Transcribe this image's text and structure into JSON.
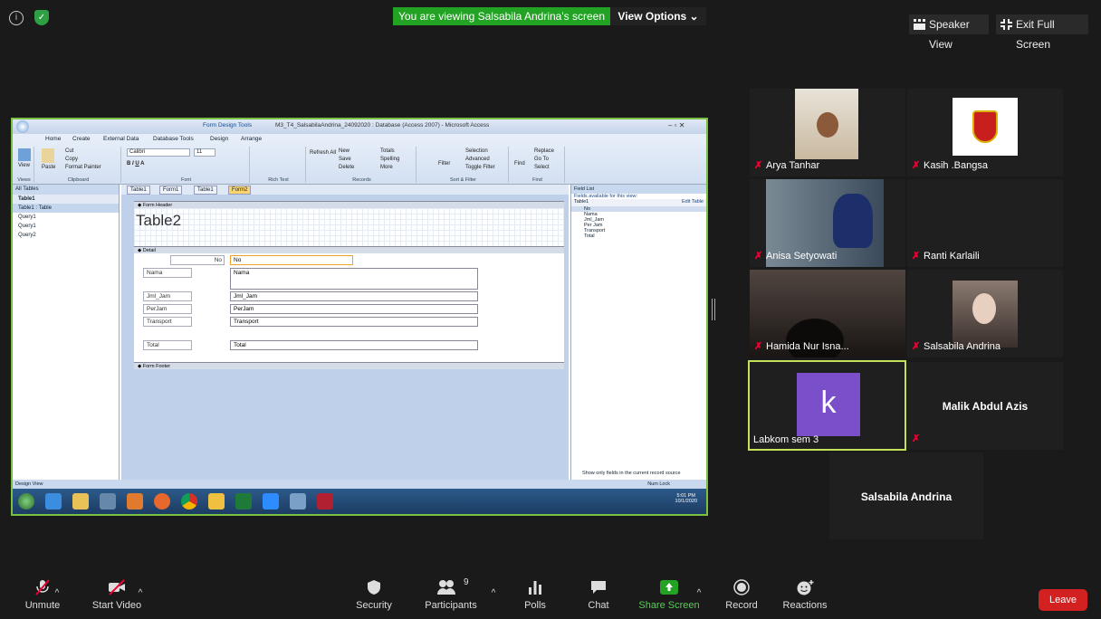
{
  "top": {
    "banner": "You are viewing Salsabila Andrina's screen",
    "view_options": "View Options ⌄",
    "speaker_view": "Speaker View",
    "exit_full_screen": "Exit Full Screen"
  },
  "access": {
    "contextual_tab": "Form Design Tools",
    "window_title": "M3_T4_SalsabilaAndrina_24092020 : Database (Access 2007) - Microsoft Access",
    "ribbon_tabs": [
      "Home",
      "Create",
      "External Data",
      "Database Tools",
      "Design",
      "Arrange"
    ],
    "groups": [
      "Views",
      "Clipboard",
      "Font",
      "Rich Text",
      "Records",
      "Sort & Filter",
      "Find"
    ],
    "clipboard": [
      "Cut",
      "Copy",
      "Format Painter"
    ],
    "view_label": "View",
    "paste_label": "Paste",
    "font_name": "Calibri",
    "font_size": "11",
    "records": [
      "New",
      "Save",
      "Delete",
      "Totals",
      "Spelling",
      "More"
    ],
    "refresh": "Refresh All",
    "sort_filter": [
      "Selection",
      "Advanced",
      "Toggle Filter"
    ],
    "filter": "Filter",
    "find": [
      "Replace",
      "Go To",
      "Select"
    ],
    "find_label": "Find",
    "nav_header": "All Tables",
    "nav_group": "Table1",
    "nav_items": [
      "Table1 : Table",
      "Query1",
      "Query1",
      "Query2"
    ],
    "doc_tabs": [
      "Table1",
      "Form1",
      "Table1",
      "Form2"
    ],
    "form_header": "Form Header",
    "form_title": "Table2",
    "detail": "Detail",
    "form_footer": "Form Footer",
    "fields": [
      {
        "label": "No",
        "box": "No"
      },
      {
        "label": "Nama",
        "box": "Nama"
      },
      {
        "label": "Jml_Jam",
        "box": "Jml_Jam"
      },
      {
        "label": "PerJam",
        "box": "PerJam"
      },
      {
        "label": "Transport",
        "box": "Transport"
      },
      {
        "label": "Total",
        "box": "Total"
      }
    ],
    "field_list_title": "Field List",
    "field_list_sub": "Fields available for this view:",
    "field_list_table": "Table1",
    "edit_table": "Edit Table",
    "field_list_items": [
      "No",
      "Nama",
      "Jml_Jam",
      "Per Jam",
      "Transport",
      "Total"
    ],
    "show_only": "Show only fields in the current record source",
    "status_left": "Design View",
    "status_right": "Num Lock",
    "clock_time": "5:01 PM",
    "clock_date": "10/1/2020"
  },
  "participants": [
    {
      "name": "Arya Tanhar"
    },
    {
      "name": "Kasih .Bangsa"
    },
    {
      "name": "Anisa Setyowati"
    },
    {
      "name": "Ranti Karlaili"
    },
    {
      "name": "Hamida Nur Isna..."
    },
    {
      "name": "Salsabila Andrina"
    },
    {
      "name": "Labkom sem 3",
      "avatar": "k"
    },
    {
      "name": "Malik Abdul Azis"
    },
    {
      "name": "Salsabila Andrina"
    }
  ],
  "toolbar": {
    "unmute": "Unmute",
    "start_video": "Start Video",
    "security": "Security",
    "participants": "Participants",
    "participants_count": "9",
    "polls": "Polls",
    "chat": "Chat",
    "share_screen": "Share Screen",
    "record": "Record",
    "reactions": "Reactions",
    "leave": "Leave"
  },
  "colors": {
    "accent_green": "#23a323",
    "leave_red": "#d32020",
    "active_border": "#c5e05a",
    "avatar_purple": "#7a4fc9"
  }
}
